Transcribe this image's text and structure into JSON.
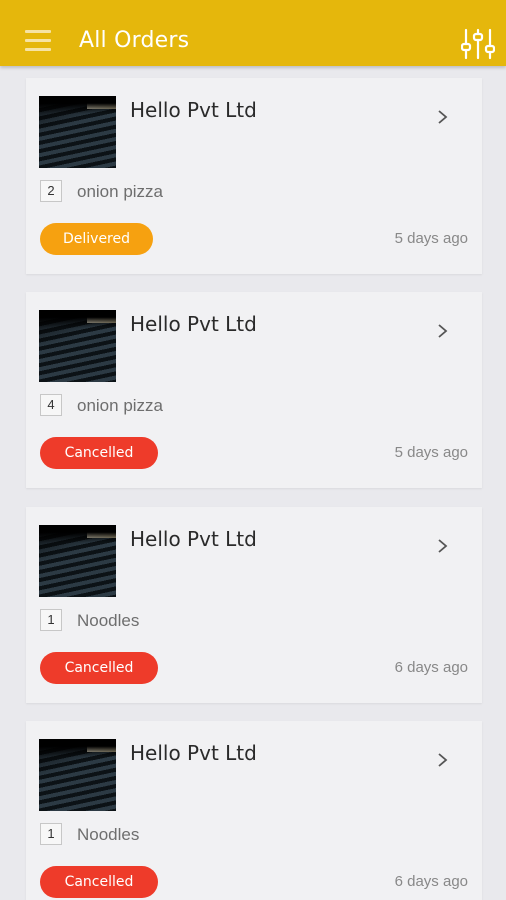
{
  "header": {
    "title": "All Orders",
    "menu_icon": "hamburger-menu-icon",
    "filter_icon": "filter-sliders-icon"
  },
  "colors": {
    "appbar": "#e5b70c",
    "delivered": "#f6a110",
    "cancelled": "#ee3b2a",
    "background": "#e9e9ed",
    "card": "#f1f1f3"
  },
  "orders": [
    {
      "restaurant": "Hello Pvt Ltd",
      "quantity": "2",
      "item": "onion pizza",
      "status": "Delivered",
      "time": "5 days ago"
    },
    {
      "restaurant": "Hello Pvt Ltd",
      "quantity": "4",
      "item": "onion pizza",
      "status": "Cancelled",
      "time": "5 days ago"
    },
    {
      "restaurant": "Hello Pvt Ltd",
      "quantity": "1",
      "item": "Noodles",
      "status": "Cancelled",
      "time": "6 days ago"
    },
    {
      "restaurant": "Hello Pvt Ltd",
      "quantity": "1",
      "item": "Noodles",
      "status": "Cancelled",
      "time": "6 days ago"
    }
  ]
}
